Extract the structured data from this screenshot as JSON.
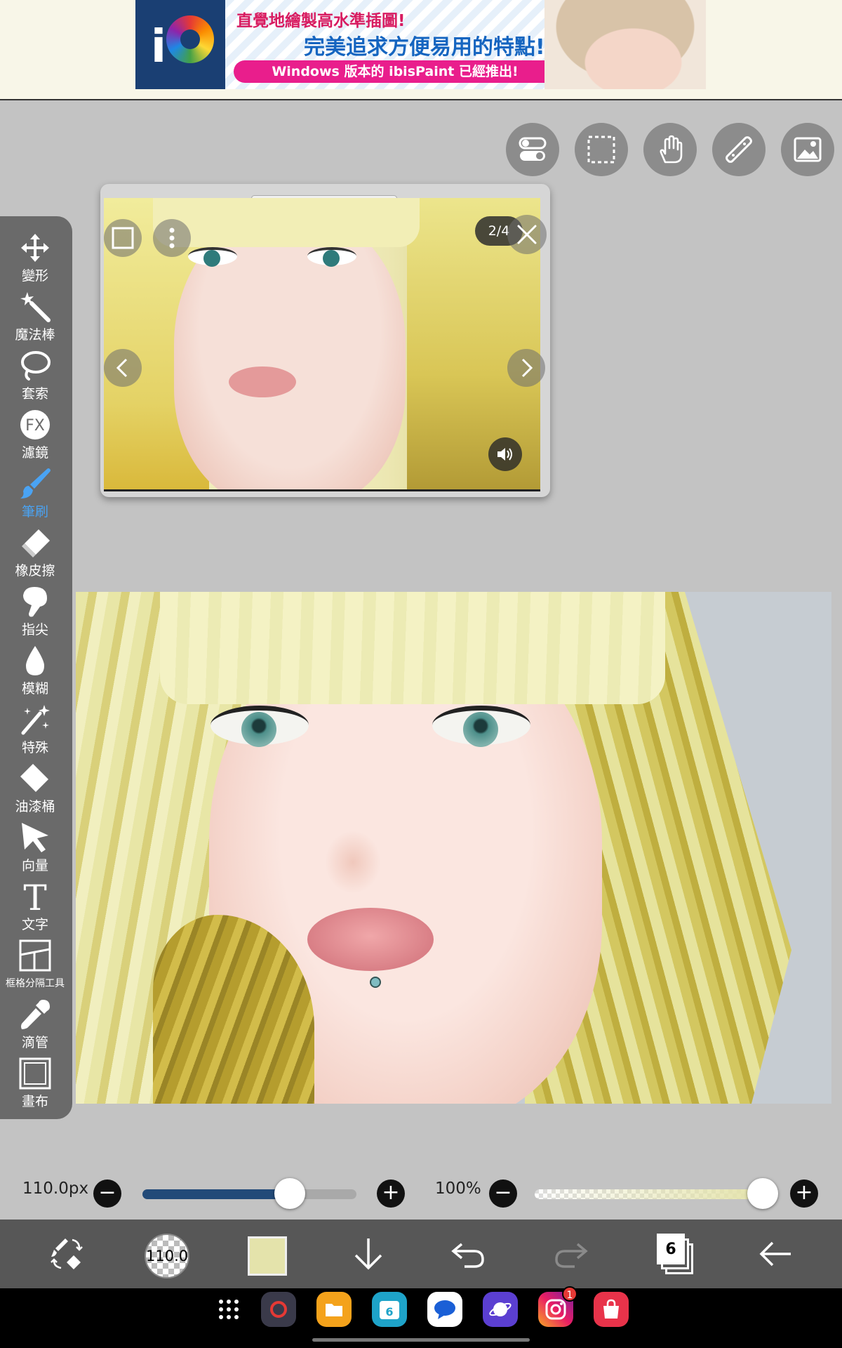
{
  "ad": {
    "line1": "直覺地繪製高水準插圖!",
    "line2": "完美追求方便易用的特點!",
    "line3": "Windows 版本的 ibisPaint 已經推出!",
    "logo_glyph": "i"
  },
  "top_tools": [
    "toggle-icon",
    "selection-icon",
    "hand-icon",
    "ruler-icon",
    "reference-image-icon"
  ],
  "toolbar": {
    "tools": [
      {
        "id": "transform",
        "label": "變形",
        "icon": "move-icon"
      },
      {
        "id": "magic-wand",
        "label": "魔法棒",
        "icon": "magic-wand-icon"
      },
      {
        "id": "lasso",
        "label": "套索",
        "icon": "lasso-icon"
      },
      {
        "id": "filter",
        "label": "濾鏡",
        "icon": "fx-icon",
        "glyph": "FX"
      },
      {
        "id": "brush",
        "label": "筆刷",
        "icon": "brush-icon",
        "active": true
      },
      {
        "id": "eraser",
        "label": "橡皮擦",
        "icon": "eraser-icon"
      },
      {
        "id": "smudge",
        "label": "指尖",
        "icon": "smudge-icon"
      },
      {
        "id": "blur",
        "label": "模糊",
        "icon": "blur-drop-icon"
      },
      {
        "id": "special",
        "label": "特殊",
        "icon": "sparkle-icon"
      },
      {
        "id": "fill",
        "label": "油漆桶",
        "icon": "fill-icon"
      },
      {
        "id": "vector",
        "label": "向量",
        "icon": "vector-arrow-icon"
      },
      {
        "id": "text",
        "label": "文字",
        "icon": "text-icon",
        "glyph": "T"
      },
      {
        "id": "frame-divider",
        "label": "框格分隔工具",
        "icon": "frame-divider-icon"
      },
      {
        "id": "eyedropper",
        "label": "滴管",
        "icon": "eyedropper-icon"
      },
      {
        "id": "canvas",
        "label": "畫布",
        "icon": "canvas-icon"
      }
    ]
  },
  "reference": {
    "counter": "2/4"
  },
  "brush": {
    "size_label": "110.0px",
    "size_fraction": 0.69,
    "opacity_label": "100%",
    "opacity_fraction": 1.0,
    "thumb_label": "110.0",
    "color": "#e4e3ab"
  },
  "layers": {
    "count": "6"
  },
  "dock": {
    "calendar_day": "6",
    "instagram_badge": "1"
  },
  "colors": {
    "accent": "#4aa3f3",
    "slider_fill": "#224a78"
  }
}
